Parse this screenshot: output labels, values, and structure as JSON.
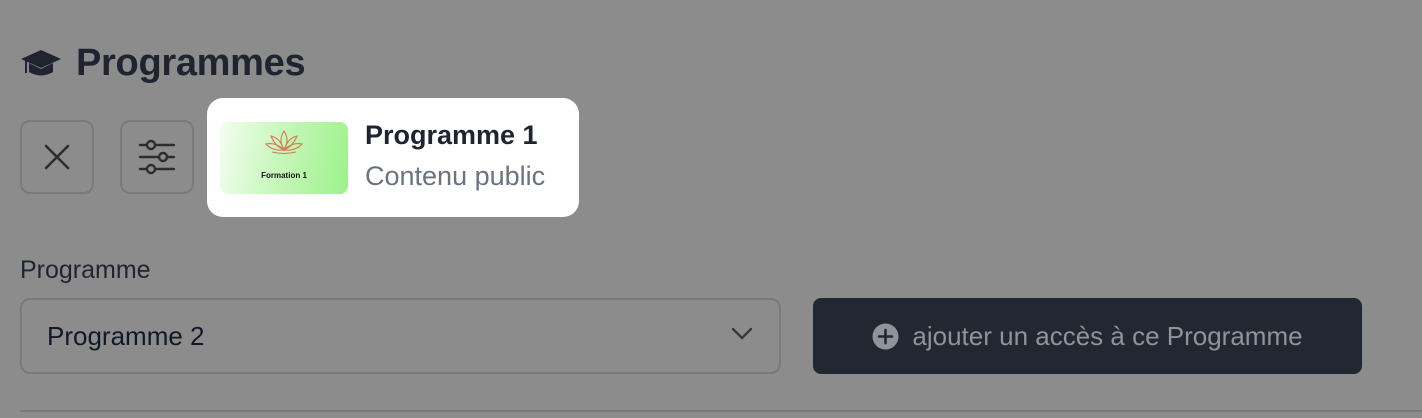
{
  "header": {
    "title": "Programmes",
    "icon": "graduation-cap-icon"
  },
  "toolbar": {
    "close_icon": "close-icon",
    "filter_icon": "sliders-icon"
  },
  "card": {
    "title": "Programme 1",
    "subtitle": "Contenu public",
    "thumbnail_label": "Formation 1",
    "thumbnail_icon": "lotus-icon"
  },
  "form": {
    "label": "Programme",
    "selected_value": "Programme 2",
    "chevron_icon": "chevron-down-icon"
  },
  "add_button": {
    "label": "ajouter un accès à ce Programme",
    "icon": "plus-circle-icon"
  },
  "colors": {
    "overlay_background": "#8c8c8c",
    "card_background": "#ffffff",
    "button_background": "#222832",
    "button_text": "#8f939a",
    "title_text": "#1f2430"
  }
}
